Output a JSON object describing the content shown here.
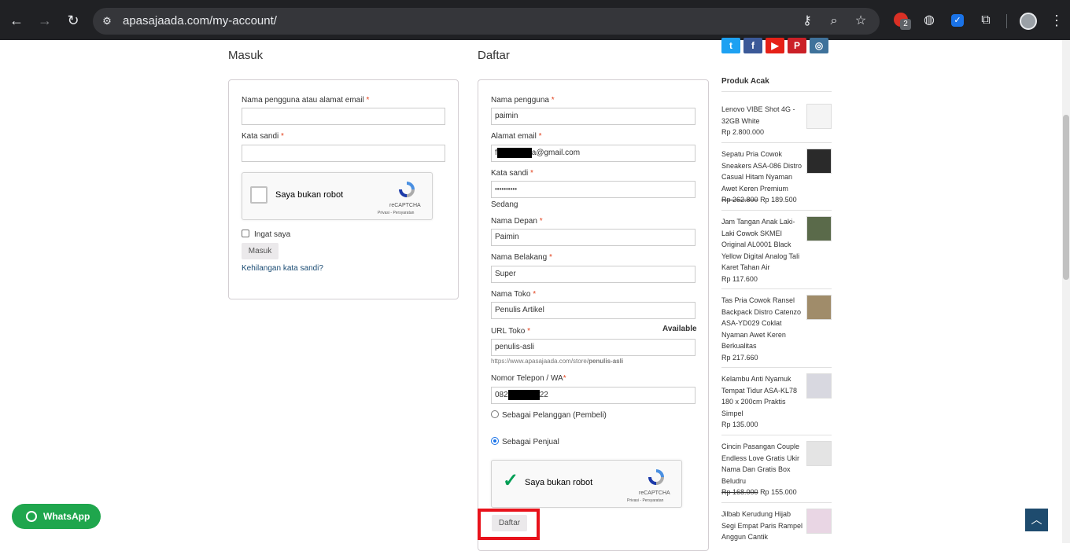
{
  "browser": {
    "url": "apasajaada.com/my-account/",
    "ext_badge": "2"
  },
  "login": {
    "title": "Masuk",
    "username_label": "Nama pengguna atau alamat email",
    "password_label": "Kata sandi",
    "required": "*",
    "captcha_text": "Saya bukan robot",
    "captcha_brand": "reCAPTCHA",
    "captcha_terms": "Privasi - Persyaratan",
    "remember_label": "Ingat saya",
    "submit_label": "Masuk",
    "lost_password": "Kehilangan kata sandi?"
  },
  "register": {
    "title": "Daftar",
    "username_label": "Nama pengguna",
    "username_value": "paimin",
    "email_label": "Alamat email",
    "email_prefix": "f",
    "email_suffix": "a@gmail.com",
    "password_label": "Kata sandi",
    "password_value": "••••••••••",
    "strength": "Sedang",
    "first_name_label": "Nama Depan",
    "first_name_value": "Paimin",
    "last_name_label": "Nama Belakang",
    "last_name_value": "Super",
    "shop_name_label": "Nama Toko",
    "shop_name_value": "Penulis Artikel",
    "shop_url_label": "URL Toko",
    "shop_url_status": "Available",
    "shop_url_value": "penulis-asli",
    "shop_url_hint_prefix": "https://www.apasajaada.com/store/",
    "shop_url_hint_slug": "penulis-asli",
    "phone_label": "Nomor Telepon / WA",
    "phone_prefix": "082",
    "phone_suffix": "22",
    "role_customer": "Sebagai Pelanggan (Pembeli)",
    "role_vendor": "Sebagai Penjual",
    "captcha_text": "Saya bukan robot",
    "captcha_brand": "reCAPTCHA",
    "captcha_terms": "Privasi - Persyaratan",
    "submit_label": "Daftar"
  },
  "sidebar": {
    "social": [
      "t",
      "f",
      "▶",
      "P",
      "◎"
    ],
    "social_colors": [
      "#1da1f2",
      "#3b5998",
      "#e62117",
      "#cb2027",
      "#3f729b"
    ],
    "title": "Produk Acak",
    "products": [
      {
        "name": "Lenovo VIBE Shot 4G - 32GB White",
        "old": "",
        "price": "Rp 2.800.000"
      },
      {
        "name": "Sepatu Pria Cowok Sneakers ASA-086 Distro Casual Hitam Nyaman Awet Keren Premium",
        "old": "Rp 262.800",
        "price": "Rp 189.500"
      },
      {
        "name": "Jam Tangan Anak Laki-Laki Cowok SKMEI Original AL0001 Black Yellow Digital Analog Tali Karet Tahan Air",
        "old": "",
        "price": "Rp 117.600"
      },
      {
        "name": "Tas Pria Cowok Ransel Backpack Distro Catenzo ASA-YD029 Coklat Nyaman Awet Keren Berkualitas",
        "old": "",
        "price": "Rp 217.660"
      },
      {
        "name": "Kelambu Anti Nyamuk Tempat Tidur ASA-KL78 180 x 200cm Praktis Simpel",
        "old": "",
        "price": "Rp 135.000"
      },
      {
        "name": "Cincin Pasangan Couple Endless Love Gratis Ukir Nama Dan Gratis Box Beludru",
        "old": "Rp 168.000",
        "price": "Rp 155.000"
      },
      {
        "name": "Jilbab Kerudung Hijab Segi Empat Paris Rampel Anggun Cantik",
        "old": "",
        "price": ""
      }
    ]
  },
  "whatsapp_label": "WhatsApp"
}
